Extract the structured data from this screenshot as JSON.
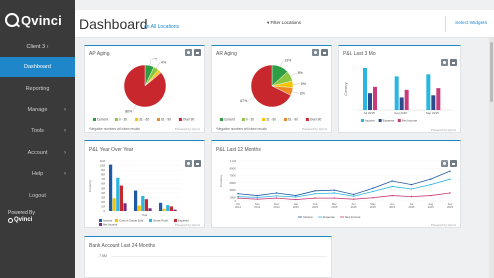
{
  "sidebar": {
    "logo_text": "Qvinci",
    "client": "Client 3",
    "items": [
      {
        "label": "Dashboard",
        "chevron": false,
        "active": true
      },
      {
        "label": "Reporting",
        "chevron": false
      },
      {
        "label": "Manage",
        "chevron": true
      },
      {
        "label": "Tools",
        "chevron": true
      },
      {
        "label": "Account",
        "chevron": true
      },
      {
        "label": "Help",
        "chevron": true
      },
      {
        "label": "Logout",
        "chevron": false
      }
    ],
    "powered_by": "Powered By",
    "powered_logo": "Qvinci"
  },
  "header": {
    "title": "Dashboard",
    "subtitle": "on All Locations",
    "filter_label": "Filter Locations",
    "widgets_label": "Select Widgets"
  },
  "cards": {
    "ap_aging": {
      "title": "AP Aging",
      "note": "*Negative numbers will skew results",
      "powered": "Powered by Qvinci"
    },
    "ar_aging": {
      "title": "AR Aging",
      "note": "*Negative numbers will skew results",
      "powered": "Powered by Qvinci"
    },
    "pl_3mo": {
      "title": "P&L Last 3 Mo",
      "powered": "Powered by Qvinci"
    },
    "pl_yoy": {
      "title": "P&L Year Over Year",
      "powered": "Powered by Qvinci"
    },
    "pl_12mo": {
      "title": "P&L Last 12 Months",
      "powered": "Powered by Qvinci"
    },
    "bank": {
      "title": "Bank Account Last 24 Months",
      "first_tick": "7.5M"
    }
  },
  "chart_data": [
    {
      "type": "pie",
      "title": "AP Aging",
      "categories": [
        "Current",
        "0 - 30",
        "31 - 60",
        "61 - 90",
        "Over 90"
      ],
      "values": [
        7,
        4,
        2,
        1,
        86
      ],
      "labels": [
        "7%",
        "4%",
        "",
        "",
        "86%"
      ],
      "colors": [
        "#2e9e44",
        "#8cc63f",
        "#f5c400",
        "#f08a24",
        "#c8282d"
      ]
    },
    {
      "type": "pie",
      "title": "AR Aging",
      "categories": [
        "Current",
        "0 - 30",
        "31 - 60",
        "61 - 90",
        "Over 90"
      ],
      "values": [
        13,
        8,
        5,
        6,
        67
      ],
      "labels": [
        "13%",
        "8%",
        "5%",
        "6%",
        "67%"
      ],
      "colors": [
        "#2e9e44",
        "#8cc63f",
        "#f5c400",
        "#f08a24",
        "#c8282d"
      ]
    },
    {
      "type": "bar",
      "title": "P&L Last 3 Mo",
      "ylabel": "Currency",
      "categories": [
        "Jul 2015",
        "Aug 2015",
        "Sep 2015"
      ],
      "series": [
        {
          "name": "Income",
          "color": "#29b6e0",
          "values": [
            100,
            80,
            85
          ]
        },
        {
          "name": "Expense",
          "color": "#2d4a8a",
          "values": [
            40,
            30,
            35
          ]
        },
        {
          "name": "Net Income",
          "color": "#c83a7a",
          "values": [
            55,
            48,
            52
          ]
        }
      ]
    },
    {
      "type": "bar",
      "title": "P&L Year Over Year",
      "ylabel": "Currency",
      "xlabel": "Year",
      "ylim": [
        0,
        11
      ],
      "yticks": [
        "11M",
        "10M",
        "9M",
        "8M",
        "7M",
        "6M",
        "5M",
        "4M",
        "3M",
        "2M",
        "1M",
        "0"
      ],
      "categories": [
        "2013",
        "2014",
        "2015"
      ],
      "series": [
        {
          "name": "Income",
          "color": "#1f5aa6",
          "values": [
            10.2,
            4.5,
            1.8
          ]
        },
        {
          "name": "Cost of Goods Sold",
          "color": "#f5c400",
          "values": [
            2.8,
            1.2,
            0.5
          ]
        },
        {
          "name": "Gross Profit",
          "color": "#29b6e0",
          "values": [
            7.3,
            3.3,
            1.3
          ]
        },
        {
          "name": "Expense",
          "color": "#c8282d",
          "values": [
            5.6,
            2.6,
            1.0
          ]
        },
        {
          "name": "Net Income",
          "color": "#7a2a7a",
          "values": [
            1.7,
            0.6,
            0.3
          ]
        }
      ]
    },
    {
      "type": "line",
      "title": "P&L Last 12 Months",
      "ylabel": "Currency",
      "ylim": [
        0,
        1.1
      ],
      "yticks": [
        "1.1M",
        "1M",
        "900K",
        "800K",
        "700K",
        "600K",
        "500K",
        "400K",
        "300K",
        "200K",
        "100K",
        "0"
      ],
      "categories": [
        "Oct 2014",
        "Nov 2014",
        "Dec 2014",
        "Jan 2015",
        "Feb 2015",
        "Mar 2015",
        "Apr 2015",
        "May 2015",
        "Jun 2015",
        "Jul 2015",
        "Aug 2015",
        "Sep 2015"
      ],
      "series": [
        {
          "name": "Income",
          "color": "#1f5aa6",
          "values": [
            0.2,
            0.15,
            0.22,
            0.15,
            0.28,
            0.3,
            0.18,
            0.35,
            0.55,
            0.45,
            0.6,
            0.82
          ]
        },
        {
          "name": "Expense",
          "color": "#29b6e0",
          "values": [
            0.12,
            0.1,
            0.14,
            0.11,
            0.2,
            0.22,
            0.13,
            0.26,
            0.4,
            0.33,
            0.45,
            0.6
          ]
        },
        {
          "name": "Net Income",
          "color": "#c83a7a",
          "values": [
            0.08,
            0.05,
            0.08,
            0.04,
            0.08,
            0.08,
            0.05,
            0.09,
            0.15,
            0.12,
            0.15,
            0.22
          ]
        }
      ]
    }
  ]
}
